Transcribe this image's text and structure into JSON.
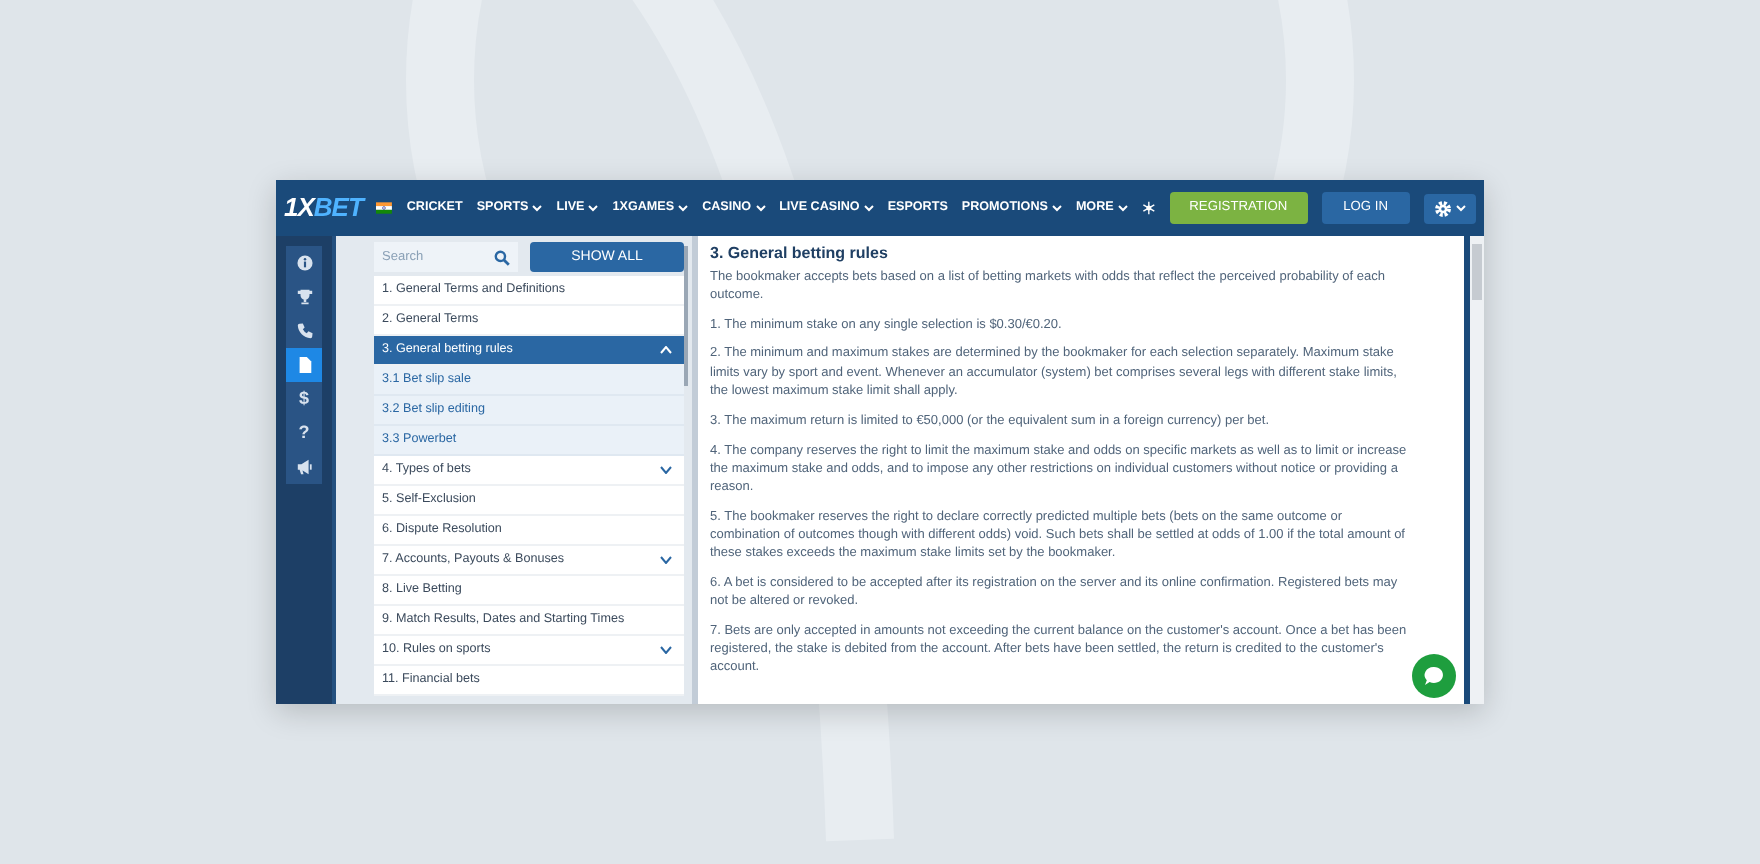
{
  "navbar": {
    "logo": {
      "lead": "1X",
      "tail": "BET"
    },
    "menu": [
      {
        "label": "CRICKET",
        "dropdown": false
      },
      {
        "label": "SPORTS",
        "dropdown": true
      },
      {
        "label": "LIVE",
        "dropdown": true
      },
      {
        "label": "1XGAMES",
        "dropdown": true
      },
      {
        "label": "CASINO",
        "dropdown": true
      },
      {
        "label": "LIVE CASINO",
        "dropdown": true
      },
      {
        "label": "ESPORTS",
        "dropdown": false
      },
      {
        "label": "PROMOTIONS",
        "dropdown": true
      },
      {
        "label": "MORE",
        "dropdown": true
      }
    ],
    "register_button": "REGISTRATION",
    "login_button": "LOG IN"
  },
  "sidebar": {
    "items": [
      {
        "kind": "info",
        "selected": false
      },
      {
        "kind": "trophy",
        "selected": false
      },
      {
        "kind": "phone",
        "selected": false
      },
      {
        "kind": "document",
        "selected": true
      },
      {
        "kind": "glyph",
        "glyph": "$",
        "selected": false
      },
      {
        "kind": "glyph",
        "glyph": "?",
        "selected": false
      },
      {
        "kind": "megaphone",
        "selected": false
      }
    ]
  },
  "rules_nav": {
    "search": {
      "placeholder": "Search"
    },
    "show_all_button": "SHOW ALL",
    "items": [
      {
        "label": "1. General Terms and Definitions",
        "selected": false
      },
      {
        "label": "2. General Terms",
        "selected": false
      },
      {
        "label": "3. General betting rules",
        "selected": true,
        "expanded": true,
        "children": [
          {
            "label": "3.1 Bet slip sale"
          },
          {
            "label": "3.2 Bet slip editing"
          },
          {
            "label": "3.3 Powerbet"
          }
        ]
      },
      {
        "label": "4. Types of bets",
        "selected": false,
        "expanded": false
      },
      {
        "label": "5. Self-Exclusion",
        "selected": false
      },
      {
        "label": "6. Dispute Resolution",
        "selected": false
      },
      {
        "label": "7. Accounts, Payouts & Bonuses",
        "selected": false,
        "expanded": false
      },
      {
        "label": "8. Live Betting",
        "selected": false
      },
      {
        "label": "9. Match Results, Dates and Starting Times",
        "selected": false
      },
      {
        "label": "10. Rules on sports",
        "selected": false,
        "expanded": false
      },
      {
        "label": "11. Financial bets",
        "selected": false
      }
    ]
  },
  "article": {
    "title": "3. General betting rules",
    "paragraphs": [
      "The bookmaker accepts bets based on a list of betting markets with odds that reflect the perceived probability of each outcome.",
      "1. The minimum stake on any single selection is $0.30/€0.20.",
      "2. The minimum and maximum stakes are determined by the bookmaker for each selection separately. Maximum stake limits vary by sport and event. Whenever an accumulator (system) bet comprises several legs with different stake limits, the lowest maximum stake limit shall apply.",
      "3. The maximum return is limited to €50,000 (or the equivalent sum in a foreign currency) per bet.",
      "4. The company reserves the right to limit the maximum stake and odds on specific markets as well as to limit or increase the maximum stake and odds, and to impose any other restrictions on individual customers without notice or providing a reason.",
      "5. The bookmaker reserves the right to declare correctly predicted multiple bets (bets on the same outcome or combination of outcomes though with different odds) void. Such bets shall be settled at odds of 1.00 if the total amount of these stakes exceeds the maximum stake limits set by the bookmaker.",
      "6. A bet is considered to be accepted after its registration on the server and its online confirmation. Registered bets may not be altered or revoked.",
      "7. Bets are only accepted in amounts not exceeding the current balance on the customer's account. Once a bet has been registered, the stake is debited from the account. After bets have been settled, the return is credited to the customer's account."
    ]
  }
}
